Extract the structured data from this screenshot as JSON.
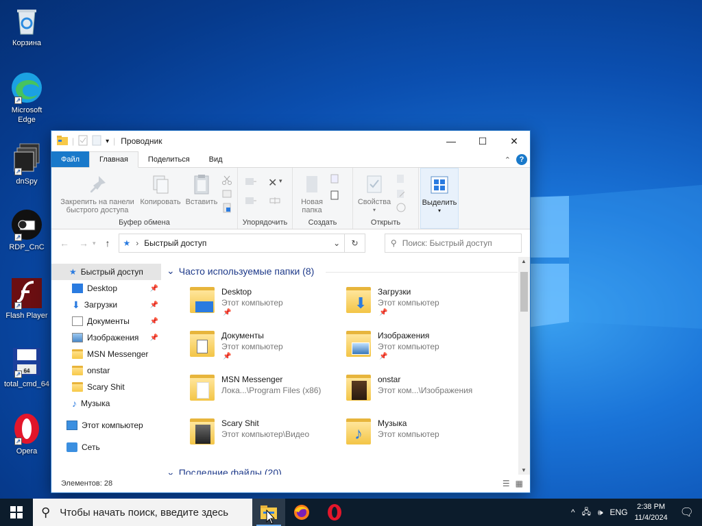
{
  "desktop": {
    "icons": [
      {
        "label": "Корзина"
      },
      {
        "label": "Microsoft Edge"
      },
      {
        "label": "dnSpy"
      },
      {
        "label": "RDP_CnC"
      },
      {
        "label": "Flash Player"
      },
      {
        "label": "total_cmd_64"
      },
      {
        "label": "Opera"
      }
    ]
  },
  "window": {
    "title": "Проводник",
    "controls": {
      "minimize": "—",
      "maximize": "☐",
      "close": "✕"
    },
    "tabs": [
      "Файл",
      "Главная",
      "Поделиться",
      "Вид"
    ],
    "ribbon": {
      "pin": "Закрепить на панели быстрого доступа",
      "copy": "Копировать",
      "paste": "Вставить",
      "clipboard_group": "Буфер обмена",
      "organize_group": "Упорядочить",
      "new_folder": "Новая папка",
      "create_group": "Создать",
      "properties": "Свойства",
      "open_group": "Открыть",
      "select": "Выделить"
    },
    "address": {
      "path": "Быстрый доступ",
      "search_placeholder": "Поиск: Быстрый доступ"
    },
    "nav": {
      "quick_access": "Быстрый доступ",
      "items": [
        {
          "label": "Desktop",
          "pinned": true
        },
        {
          "label": "Загрузки",
          "pinned": true
        },
        {
          "label": "Документы",
          "pinned": true
        },
        {
          "label": "Изображения",
          "pinned": true
        },
        {
          "label": "MSN Messenger",
          "pinned": false
        },
        {
          "label": "onstar",
          "pinned": false
        },
        {
          "label": "Scary Shit",
          "pinned": false
        },
        {
          "label": "Музыка",
          "pinned": false
        }
      ],
      "this_pc": "Этот компьютер",
      "network": "Сеть"
    },
    "content": {
      "frequent_header": "Часто используемые папки (8)",
      "recent_header": "Последние файлы (20)",
      "folders": [
        {
          "name": "Desktop",
          "location": "Этот компьютер",
          "pinned": true
        },
        {
          "name": "Загрузки",
          "location": "Этот компьютер",
          "pinned": true
        },
        {
          "name": "Документы",
          "location": "Этот компьютер",
          "pinned": true
        },
        {
          "name": "Изображения",
          "location": "Этот компьютер",
          "pinned": true
        },
        {
          "name": "MSN Messenger",
          "location": "Лока...\\Program Files (x86)",
          "pinned": false
        },
        {
          "name": "onstar",
          "location": "Этот ком...\\Изображения",
          "pinned": false
        },
        {
          "name": "Scary Shit",
          "location": "Этот компьютер\\Видео",
          "pinned": false
        },
        {
          "name": "Музыка",
          "location": "Этот компьютер",
          "pinned": false
        }
      ]
    },
    "status": "Элементов: 28"
  },
  "taskbar": {
    "search_placeholder": "Чтобы начать поиск, введите здесь",
    "lang": "ENG",
    "time": "2:38 PM",
    "date": "11/4/2024"
  },
  "colors": {
    "accent": "#1979ca",
    "taskbar": "#0c1c2c"
  }
}
